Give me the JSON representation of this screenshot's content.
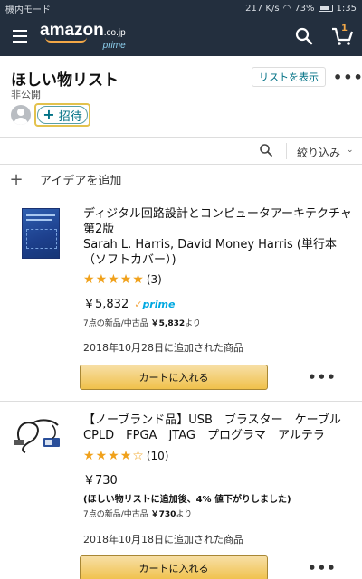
{
  "status_bar": {
    "carrier": "機内モード",
    "speed": "217 K/s",
    "battery": "73%",
    "time": "1:35"
  },
  "header": {
    "logo_text": "amazon",
    "logo_tld": ".co.jp",
    "logo_sub": "prime",
    "cart_count": "1"
  },
  "list": {
    "title": "ほしい物リスト",
    "privacy": "非公開",
    "show_list_label": "リストを表示",
    "invite_label": "招待"
  },
  "filter": {
    "label": "絞り込み"
  },
  "add_idea": {
    "label": "アイデアを追加"
  },
  "items": [
    {
      "title": "ディジタル回路設計とコンピュータアーキテクチャ 第2版",
      "byline": "Sarah L. Harris, David Money Harris (単行本（ソフトカバー）)",
      "rating_count": "(3)",
      "price": "￥5,832",
      "prime_label": "prime",
      "offers_prefix": "7点の新品/中古品",
      "offers_price": "￥5,832",
      "offers_suffix": "より",
      "added": "2018年10月28日に追加された商品",
      "cart_label": "カートに入れる"
    },
    {
      "title": "【ノーブランド品】USB　ブラスター　ケーブル　CPLD　FPGA　JTAG　プログラマ　アルテラ",
      "rating_count": "(10)",
      "price": "￥730",
      "drop_note": "(ほしい物リストに追加後、4% 値下がりしました)",
      "offers_prefix": "7点の新品/中古品",
      "offers_price": "￥730",
      "offers_suffix": "より",
      "added": "2018年10月18日に追加された商品",
      "cart_label": "カートに入れる"
    }
  ],
  "colors": {
    "header_bg": "#232f3e",
    "link": "#007185",
    "star": "#f0a11b",
    "cart_btn": "#f0c14b",
    "prime": "#00a8e1"
  }
}
